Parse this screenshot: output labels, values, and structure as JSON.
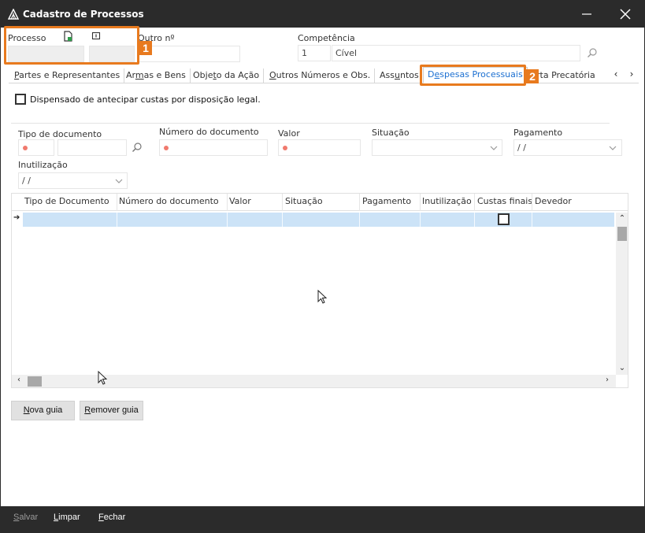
{
  "window": {
    "title": "Cadastro de Processos"
  },
  "header": {
    "processo_label": "Processo",
    "outro_label": "Outro nº",
    "competencia_label": "Competência",
    "competencia_code": "1",
    "competencia_value": "Cível"
  },
  "tabs": [
    {
      "label": "Partes e Representantes",
      "mnemonic": "P",
      "rest": "artes e Representantes"
    },
    {
      "label": "Armas e Bens",
      "pre": "Ar",
      "mnemonic": "m",
      "rest": "as e Bens"
    },
    {
      "label": "Objeto da Ação",
      "pre": "Obje",
      "mnemonic": "t",
      "rest": "o da Ação"
    },
    {
      "label": "Outros Números e Obs.",
      "mnemonic": "O",
      "rest": "utros Números e Obs."
    },
    {
      "label": "Assuntos",
      "pre": "Ass",
      "mnemonic": "u",
      "rest": "ntos"
    },
    {
      "label": "Despesas Processuais",
      "pre": "D",
      "mnemonic": "e",
      "rest": "spesas Processuais"
    },
    {
      "label": "rta Precatória"
    }
  ],
  "despesas": {
    "dispensado_label": "Dispensado de antecipar custas por disposição legal.",
    "tipo_documento_label": "Tipo de documento",
    "numero_documento_label": "Número do documento",
    "valor_label": "Valor",
    "situacao_label": "Situação",
    "pagamento_label": "Pagamento",
    "pagamento_value": "/ /",
    "inutilizacao_label": "Inutilização",
    "inutilizacao_value": "/ /"
  },
  "grid": {
    "columns": [
      "Tipo de Documento",
      "Número do documento",
      "Valor",
      "Situação",
      "Pagamento",
      "Inutilização",
      "Custas finais",
      "Devedor"
    ]
  },
  "buttons": {
    "nova_guia": {
      "mnemonic": "N",
      "rest": "ova guia"
    },
    "remover_guia": {
      "mnemonic": "R",
      "rest": "emover guia"
    }
  },
  "bottombar": {
    "salvar": {
      "mnemonic": "S",
      "rest": "alvar"
    },
    "limpar": {
      "mnemonic": "L",
      "rest": "impar"
    },
    "fechar": {
      "mnemonic": "F",
      "rest": "echar"
    }
  },
  "annotations": [
    "1",
    "2"
  ],
  "colors": {
    "highlight": "#e87a1e",
    "active_tab": "#1b6fd1",
    "row_selected": "#cce3f7",
    "titlebar": "#2b2b2b"
  }
}
